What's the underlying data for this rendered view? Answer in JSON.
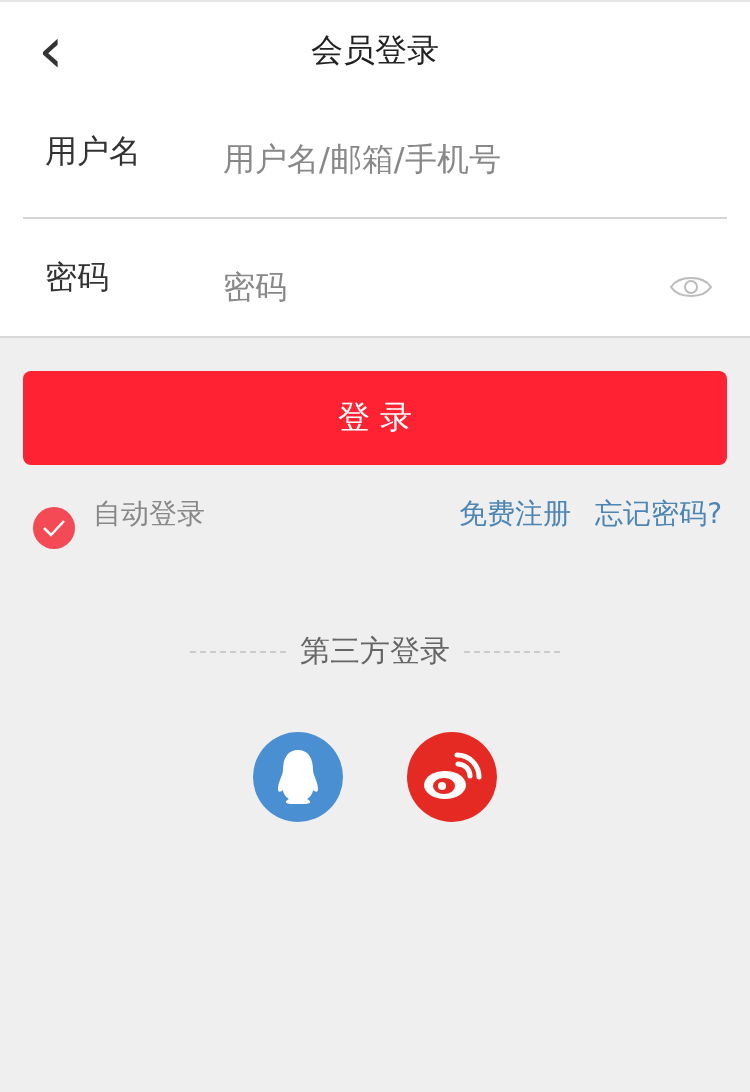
{
  "header": {
    "back": "‹",
    "title": "会员登录"
  },
  "fields": [
    {
      "label": "用户名",
      "placeholder": "用户名/邮箱/手机号",
      "kind": "text"
    },
    {
      "label": "密码",
      "placeholder": "密码",
      "kind": "password"
    }
  ],
  "login_button": "登 录",
  "auto_login": {
    "label": "自动登录",
    "checked": true
  },
  "links": [
    "免费注册",
    "忘记密码?"
  ],
  "third_party": {
    "title": "第三方登录",
    "providers": [
      {
        "kind": "qq",
        "color": "#4a8fd2"
      },
      {
        "kind": "weibo",
        "color": "#e42a22"
      }
    ]
  }
}
